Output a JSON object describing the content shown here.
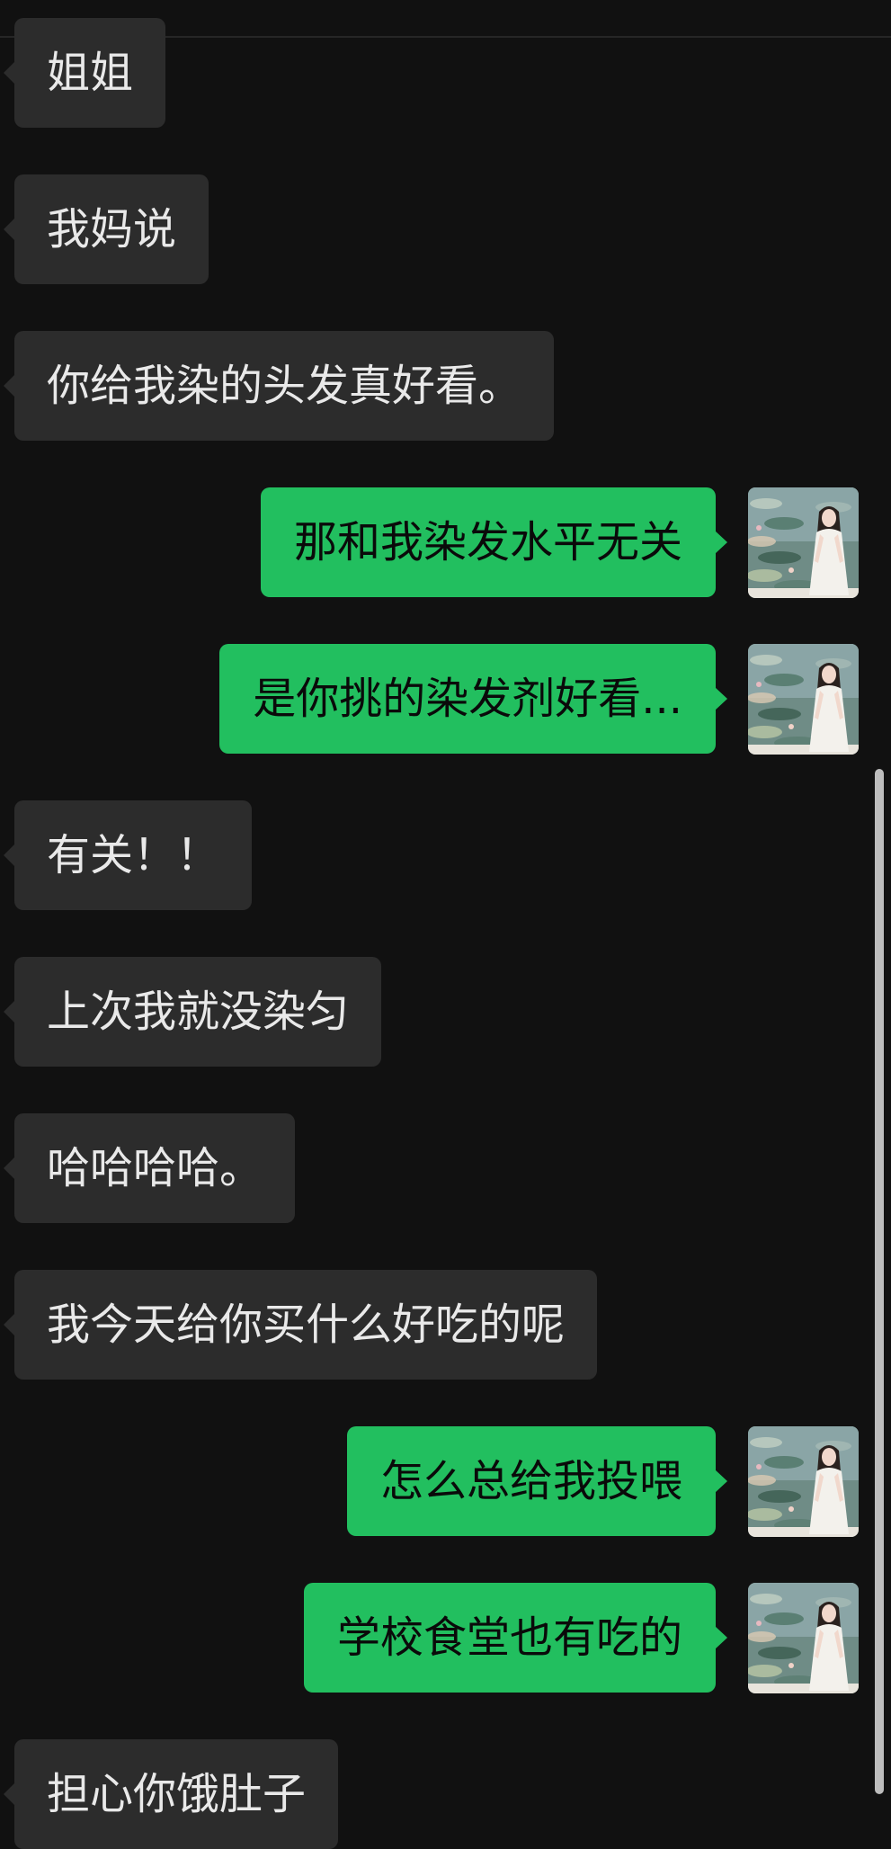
{
  "chat": {
    "messages": [
      {
        "side": "in",
        "text": "姐姐"
      },
      {
        "side": "in",
        "text": "我妈说"
      },
      {
        "side": "in",
        "text": "你给我染的头发真好看。"
      },
      {
        "side": "out",
        "text": "那和我染发水平无关"
      },
      {
        "side": "out",
        "text": "是你挑的染发剂好看..."
      },
      {
        "side": "in",
        "text": "有关！！"
      },
      {
        "side": "in",
        "text": "上次我就没染匀"
      },
      {
        "side": "in",
        "text": "哈哈哈哈。"
      },
      {
        "side": "in",
        "text": "我今天给你买什么好吃的呢"
      },
      {
        "side": "out",
        "text": "怎么总给我投喂"
      },
      {
        "side": "out",
        "text": "学校食堂也有吃的"
      },
      {
        "side": "in",
        "text": "担心你饿肚子"
      }
    ],
    "avatar": {
      "icon": "user-avatar-photo",
      "description_icon": "woman-in-white-dress-with-water-lilies-icon"
    }
  },
  "colors": {
    "background": "#111111",
    "incoming_bubble": "#2c2c2c",
    "incoming_text": "#e9e9e9",
    "outgoing_bubble": "#22bf5f",
    "outgoing_text": "#0a0a0a",
    "scrollbar": "#bdbdbd"
  }
}
